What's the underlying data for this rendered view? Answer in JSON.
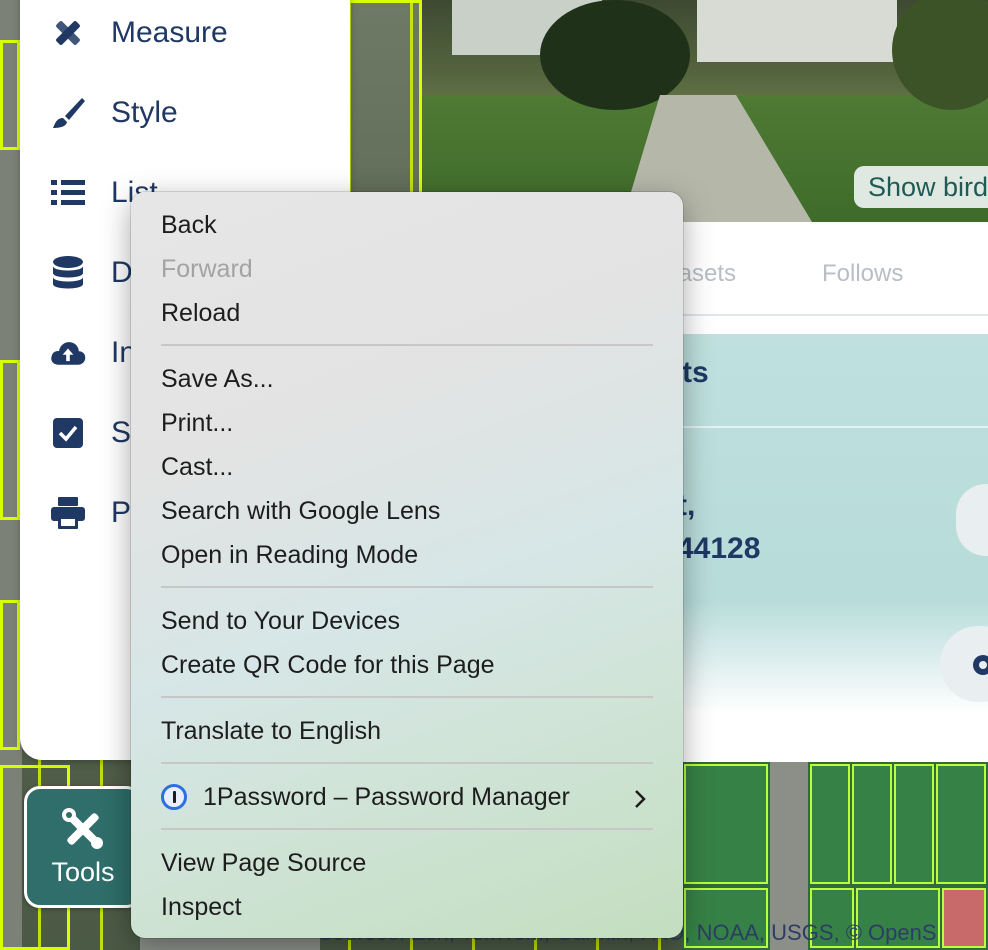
{
  "tools_panel": {
    "items": [
      {
        "label": "Measure",
        "icon": "ruler-pencil-icon"
      },
      {
        "label": "Style",
        "icon": "paintbrush-icon"
      },
      {
        "label": "List",
        "icon": "list-icon"
      },
      {
        "label": "D",
        "icon": "database-icon"
      },
      {
        "label": "In",
        "icon": "cloud-upload-icon"
      },
      {
        "label": "S",
        "icon": "checkbox-icon"
      },
      {
        "label": "P",
        "icon": "printer-icon"
      }
    ],
    "tools_button_label": "Tools"
  },
  "right_panel": {
    "show_bird_label": "Show bird",
    "tabs": [
      {
        "label": "tasets"
      },
      {
        "label": "Follows"
      }
    ],
    "card_title": "ts",
    "address_line1": "t,",
    "address_line2": "44128"
  },
  "context_menu": {
    "items": [
      {
        "label": "Back",
        "enabled": true
      },
      {
        "label": "Forward",
        "enabled": false
      },
      {
        "label": "Reload",
        "enabled": true
      },
      {
        "label": "Save As...",
        "enabled": true
      },
      {
        "label": "Print...",
        "enabled": true
      },
      {
        "label": "Cast...",
        "enabled": true
      },
      {
        "label": "Search with Google Lens",
        "enabled": true
      },
      {
        "label": "Open in Reading Mode",
        "enabled": true
      },
      {
        "label": "Send to Your Devices",
        "enabled": true
      },
      {
        "label": "Create QR Code for this Page",
        "enabled": true
      },
      {
        "label": "Translate to English",
        "enabled": true
      },
      {
        "label": "1Password – Password Manager",
        "enabled": true,
        "submenu": true
      },
      {
        "label": "View Page Source",
        "enabled": true
      },
      {
        "label": "Inspect",
        "enabled": true
      }
    ]
  },
  "map": {
    "attribution": "Sources: Esri, TomTom, Garmin, FAO, NOAA, USGS, © OpenS"
  },
  "colors": {
    "navy": "#1f3864",
    "teal": "#2f6e6a",
    "parcel_outline": "#d8ff00"
  }
}
